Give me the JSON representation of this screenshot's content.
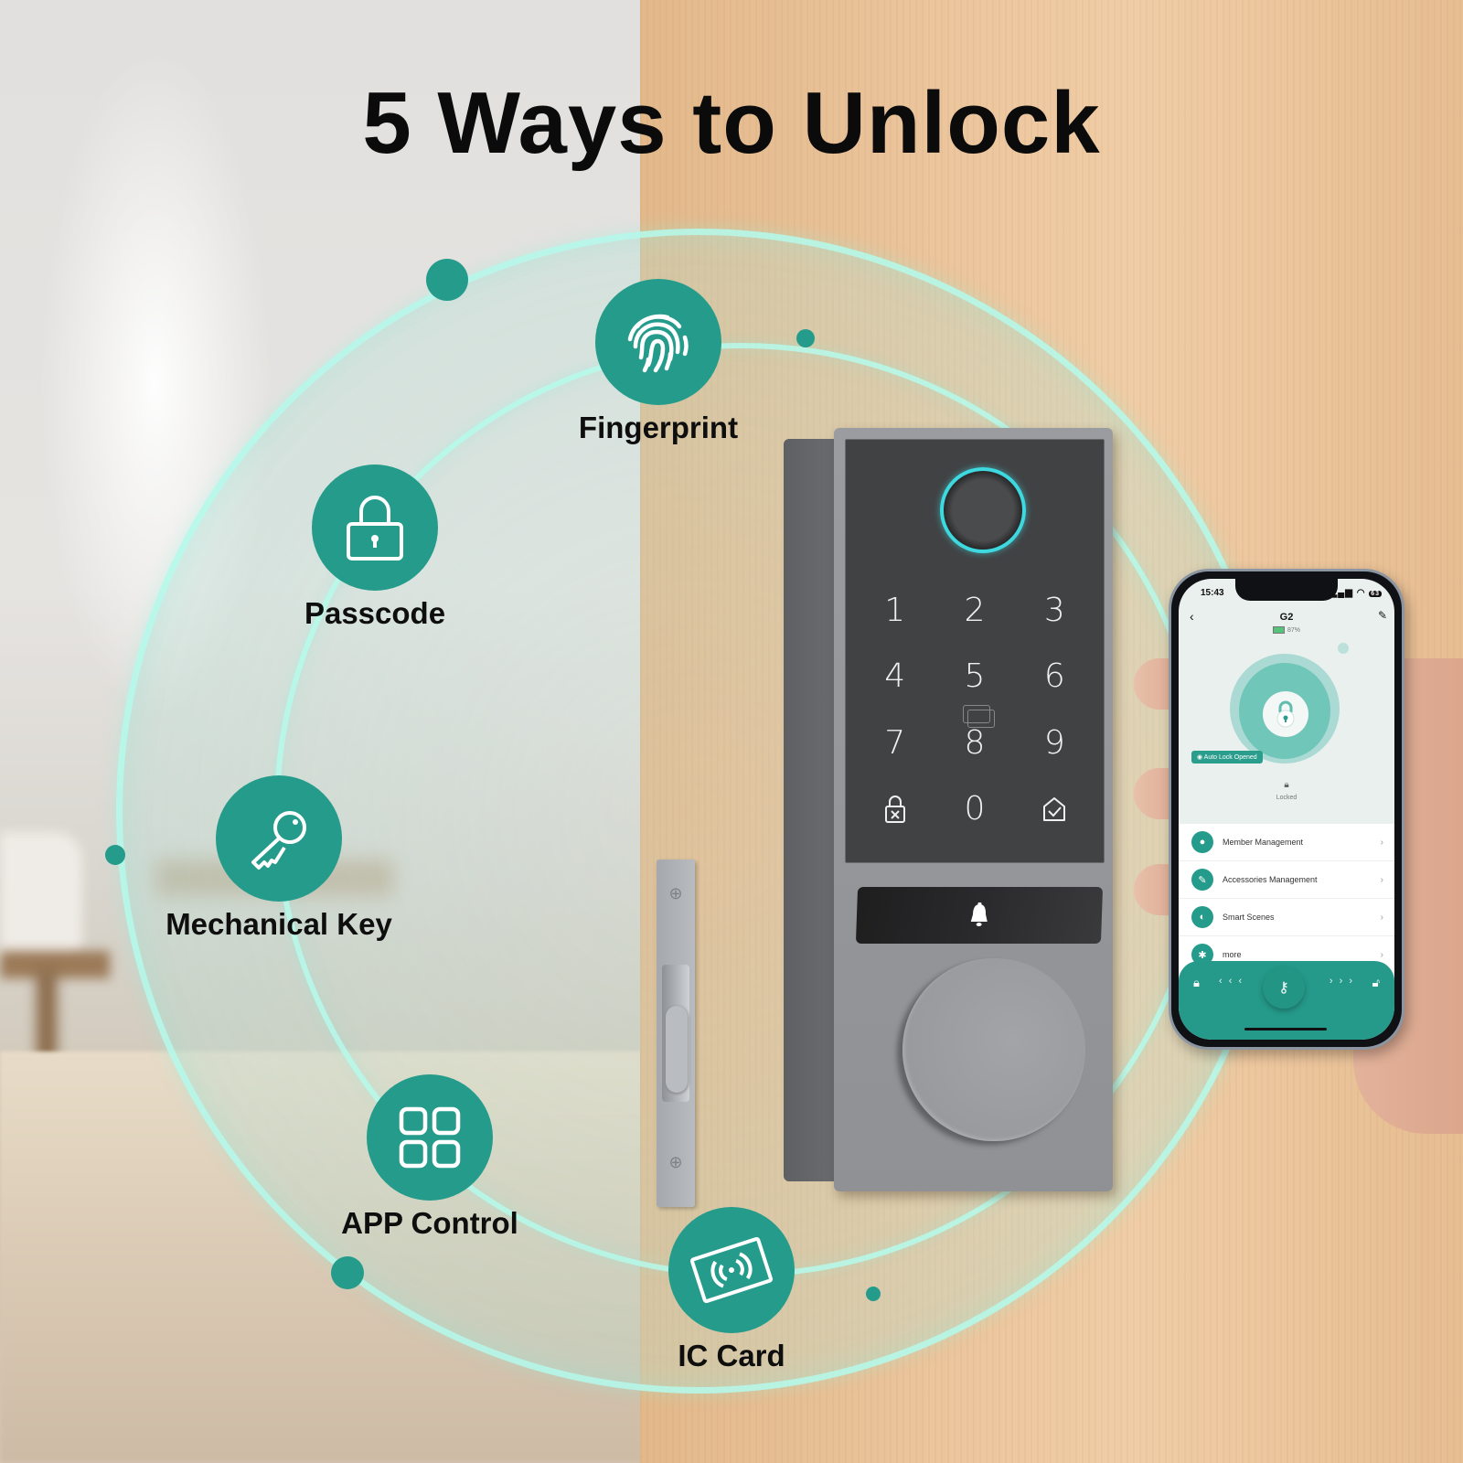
{
  "title": "5 Ways to Unlock",
  "accent_color": "#259c8b",
  "ring_color": "#b4faeb",
  "methods": [
    {
      "label": "Fingerprint",
      "icon": "fingerprint-icon"
    },
    {
      "label": "Passcode",
      "icon": "padlock-icon"
    },
    {
      "label": "Mechanical Key",
      "icon": "key-icon"
    },
    {
      "label": "APP Control",
      "icon": "app-grid-icon"
    },
    {
      "label": "IC Card",
      "icon": "nfc-card-icon"
    }
  ],
  "lock": {
    "keys": [
      "1",
      "2",
      "3",
      "4",
      "5",
      "6",
      "7",
      "8",
      "9",
      "lock-x",
      "0",
      "home-check"
    ],
    "digit_labels": {
      "k1": "1",
      "k2": "2",
      "k3": "3",
      "k4": "4",
      "k5": "5",
      "k6": "6",
      "k7": "7",
      "k8": "8",
      "k9": "9",
      "k0": "0"
    },
    "fingerprint_ring_color": "#3ed8df",
    "doorbell_icon": "bell-icon"
  },
  "phone": {
    "time": "15:43",
    "status_icons": "signal wifi battery",
    "status_battery": "63",
    "device_name": "G2",
    "battery_percent": "87%",
    "auto_lock_label": "Auto Lock Opened",
    "lock_state": "Locked",
    "menu": [
      {
        "label": "Member Management",
        "icon": "member-icon"
      },
      {
        "label": "Accessories Management",
        "icon": "accessories-icon"
      },
      {
        "label": "Smart Scenes",
        "icon": "toggle-icon"
      },
      {
        "label": "more",
        "icon": "gear-icon"
      }
    ],
    "slider_left_arrows": "‹ ‹ ‹",
    "slider_right_arrows": "› › ›"
  }
}
